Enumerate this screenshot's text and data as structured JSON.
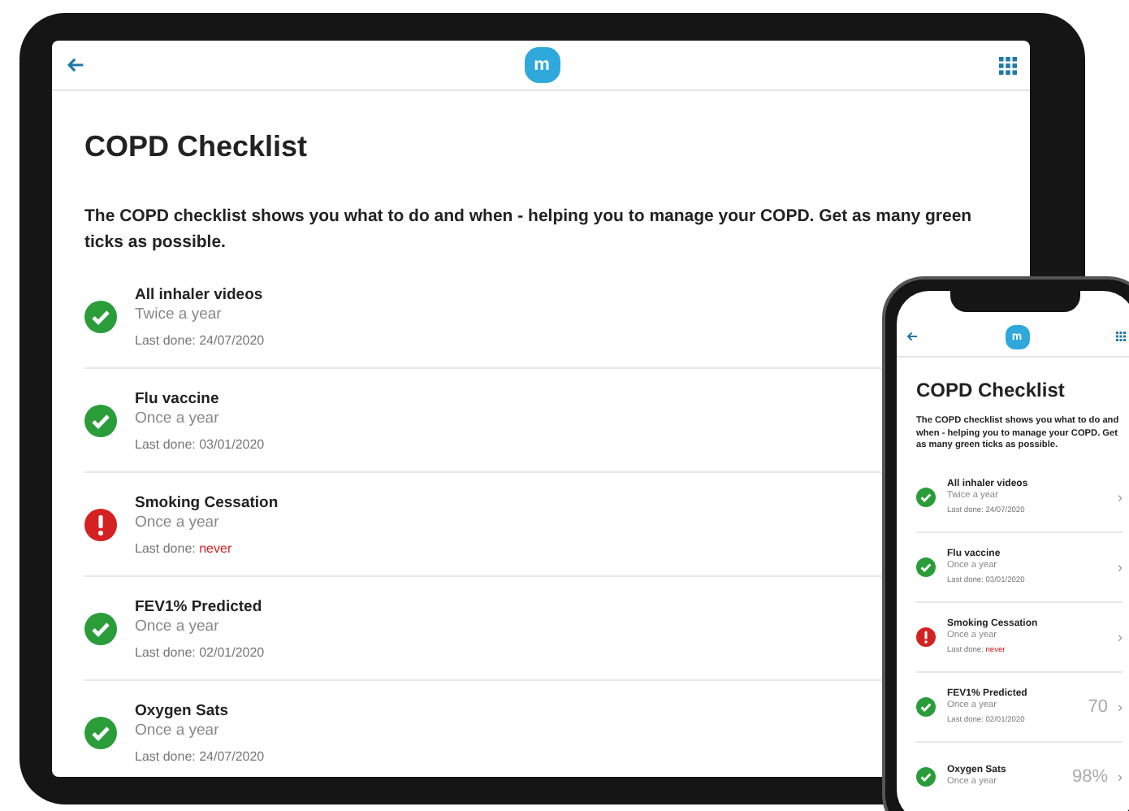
{
  "tablet": {
    "logo_letter": "m",
    "title": "COPD Checklist",
    "intro": "The COPD checklist shows you what to do and when - helping you to manage your COPD. Get as many green ticks as possible.",
    "items": [
      {
        "name": "All inhaler videos",
        "frequency": "Twice a year",
        "last_done_label": "Last done:",
        "last_done": "24/07/2020",
        "overdue": false
      },
      {
        "name": "Flu vaccine",
        "frequency": "Once a year",
        "last_done_label": "Last done:",
        "last_done": "03/01/2020",
        "overdue": false
      },
      {
        "name": "Smoking Cessation",
        "frequency": "Once a year",
        "last_done_label": "Last done:",
        "last_done": "never",
        "overdue": true
      },
      {
        "name": "FEV1% Predicted",
        "frequency": "Once a year",
        "last_done_label": "Last done:",
        "last_done": "02/01/2020",
        "overdue": false
      },
      {
        "name": "Oxygen Sats",
        "frequency": "Once a year",
        "last_done_label": "Last done:",
        "last_done": "24/07/2020",
        "overdue": false
      }
    ]
  },
  "phone": {
    "logo_letter": "m",
    "title": "COPD Checklist",
    "intro": "The COPD checklist shows you what to do and when - helping you to manage your COPD. Get as many green ticks as possible.",
    "items": [
      {
        "name": "All inhaler videos",
        "frequency": "Twice a year",
        "last_done_label": "Last done:",
        "last_done": "24/07/2020",
        "overdue": false,
        "chevron": "›"
      },
      {
        "name": "Flu vaccine",
        "frequency": "Once a year",
        "last_done_label": "Last done:",
        "last_done": "03/01/2020",
        "overdue": false,
        "chevron": "›"
      },
      {
        "name": "Smoking Cessation",
        "frequency": "Once a year",
        "last_done_label": "Last done:",
        "last_done": "never",
        "overdue": true,
        "chevron": "›"
      },
      {
        "name": "FEV1% Predicted",
        "frequency": "Once a year",
        "last_done_label": "Last done:",
        "last_done": "02/01/2020",
        "overdue": false,
        "reading": "70",
        "chevron": "›"
      },
      {
        "name": "Oxygen Sats",
        "frequency": "Once a year",
        "overdue": false,
        "reading": "98%",
        "chevron": "›"
      }
    ]
  }
}
